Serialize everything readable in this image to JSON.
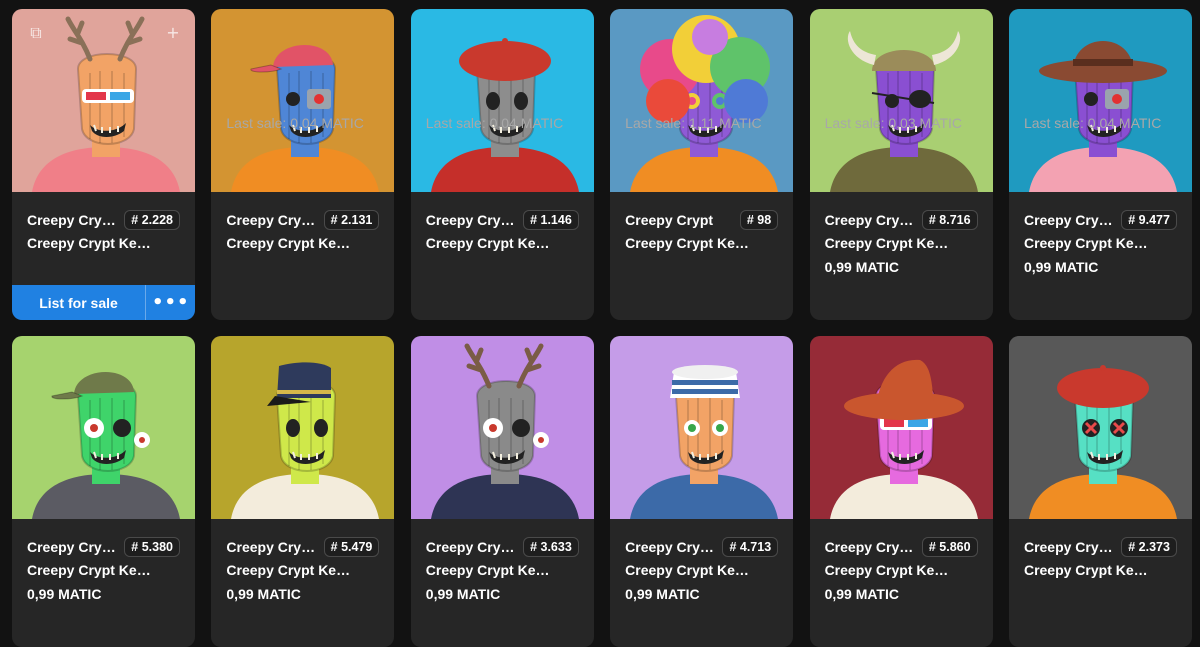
{
  "cards": [
    {
      "name": "Creepy Cry…",
      "token": "# 2.228",
      "collection": "Creepy Crypt Ke…",
      "price": "",
      "last_sale": "",
      "bg": "#e0a49b",
      "skin": "#f2a366",
      "eyes": "glasses",
      "hat": "antlers",
      "hat_color": "#8a7058",
      "body": "#f07f88",
      "owned": true
    },
    {
      "name": "Creepy Cry…",
      "token": "# 2.131",
      "collection": "Creepy Crypt Ke…",
      "price": "",
      "last_sale": "Last sale: 0,04 MATIC",
      "bg": "#d39432",
      "skin": "#4f86d6",
      "eyes": "cyborg",
      "hat": "cap",
      "hat_color": "#e15367",
      "body": "#f08d23"
    },
    {
      "name": "Creepy Cry…",
      "token": "# 1.146",
      "collection": "Creepy Crypt Ke…",
      "price": "",
      "last_sale": "Last sale: 0,04 MATIC",
      "bg": "#2ab9e4",
      "skin": "#8d8d8d",
      "eyes": "hollow",
      "hat": "beret",
      "hat_color": "#c9392d",
      "body": "#c52f2a"
    },
    {
      "name": "Creepy Crypt …",
      "token": "# 98",
      "collection": "Creepy Crypt Ke…",
      "price": "",
      "last_sale": "Last sale: 1,11 MATIC",
      "bg": "#5a99c3",
      "skin": "#8f5ad6",
      "eyes": "rainbow",
      "hat": "afro",
      "hat_color": "#f2cf38",
      "body": "#f08d23"
    },
    {
      "name": "Creepy Cry…",
      "token": "# 8.716",
      "collection": "Creepy Crypt Ke…",
      "price": "0,99 MATIC",
      "last_sale": "Last sale: 0,03 MATIC",
      "bg": "#a9cf72",
      "skin": "#8a4fd2",
      "eyes": "patch",
      "hat": "viking",
      "hat_color": "#9b8c5a",
      "body": "#6f6a3c"
    },
    {
      "name": "Creepy Cry…",
      "token": "# 9.477",
      "collection": "Creepy Crypt Ke…",
      "price": "0,99 MATIC",
      "last_sale": "Last sale: 0,04 MATIC",
      "bg": "#1f9ac0",
      "skin": "#8a4fd2",
      "eyes": "cyborg",
      "hat": "cowboy",
      "hat_color": "#8a4a32",
      "body": "#f3a2b2"
    },
    {
      "name": "Creepy Cry…",
      "token": "# 5.380",
      "collection": "Creepy Crypt Ke…",
      "price": "0,99 MATIC",
      "last_sale": "",
      "bg": "#a6d36e",
      "skin": "#3fd46a",
      "eyes": "popout",
      "hat": "cap",
      "hat_color": "#6f7a4a",
      "body": "#5b5b63"
    },
    {
      "name": "Creepy Cry…",
      "token": "# 5.479",
      "collection": "Creepy Crypt Ke…",
      "price": "0,99 MATIC",
      "last_sale": "",
      "bg": "#b7a52c",
      "skin": "#cfe84a",
      "eyes": "hollow",
      "hat": "kepi",
      "hat_color": "#2e3a5c",
      "body": "#f3ecdc"
    },
    {
      "name": "Creepy Cry…",
      "token": "# 3.633",
      "collection": "Creepy Crypt Ke…",
      "price": "0,99 MATIC",
      "last_sale": "",
      "bg": "#c08ee6",
      "skin": "#8a8a8a",
      "eyes": "popout",
      "hat": "antlers",
      "hat_color": "#7a5c46",
      "body": "#2e3454"
    },
    {
      "name": "Creepy Cry…",
      "token": "# 4.713",
      "collection": "Creepy Crypt Ke…",
      "price": "0,99 MATIC",
      "last_sale": "",
      "bg": "#c59ce8",
      "skin": "#f2a366",
      "eyes": "green",
      "hat": "sailor",
      "hat_color": "#ffffff",
      "body": "#3c6aa8"
    },
    {
      "name": "Creepy Cry…",
      "token": "# 5.860",
      "collection": "Creepy Crypt Ke…",
      "price": "0,99 MATIC",
      "last_sale": "",
      "bg": "#962b37",
      "skin": "#e66adf",
      "eyes": "glasses",
      "hat": "witch",
      "hat_color": "#c9562e",
      "body": "#f3ecdc"
    },
    {
      "name": "Creepy Cry…",
      "token": "# 2.373",
      "collection": "Creepy Crypt Ke…",
      "price": "",
      "last_sale": "",
      "bg": "#585858",
      "skin": "#56e0c4",
      "eyes": "xeyes",
      "hat": "beret",
      "hat_color": "#c9392d",
      "body": "#f08d23"
    }
  ],
  "actions": {
    "list_label": "List for sale",
    "more_label": "•••"
  },
  "overlay": {
    "left_icon": "layers-icon",
    "right_icon": "plus-icon"
  }
}
